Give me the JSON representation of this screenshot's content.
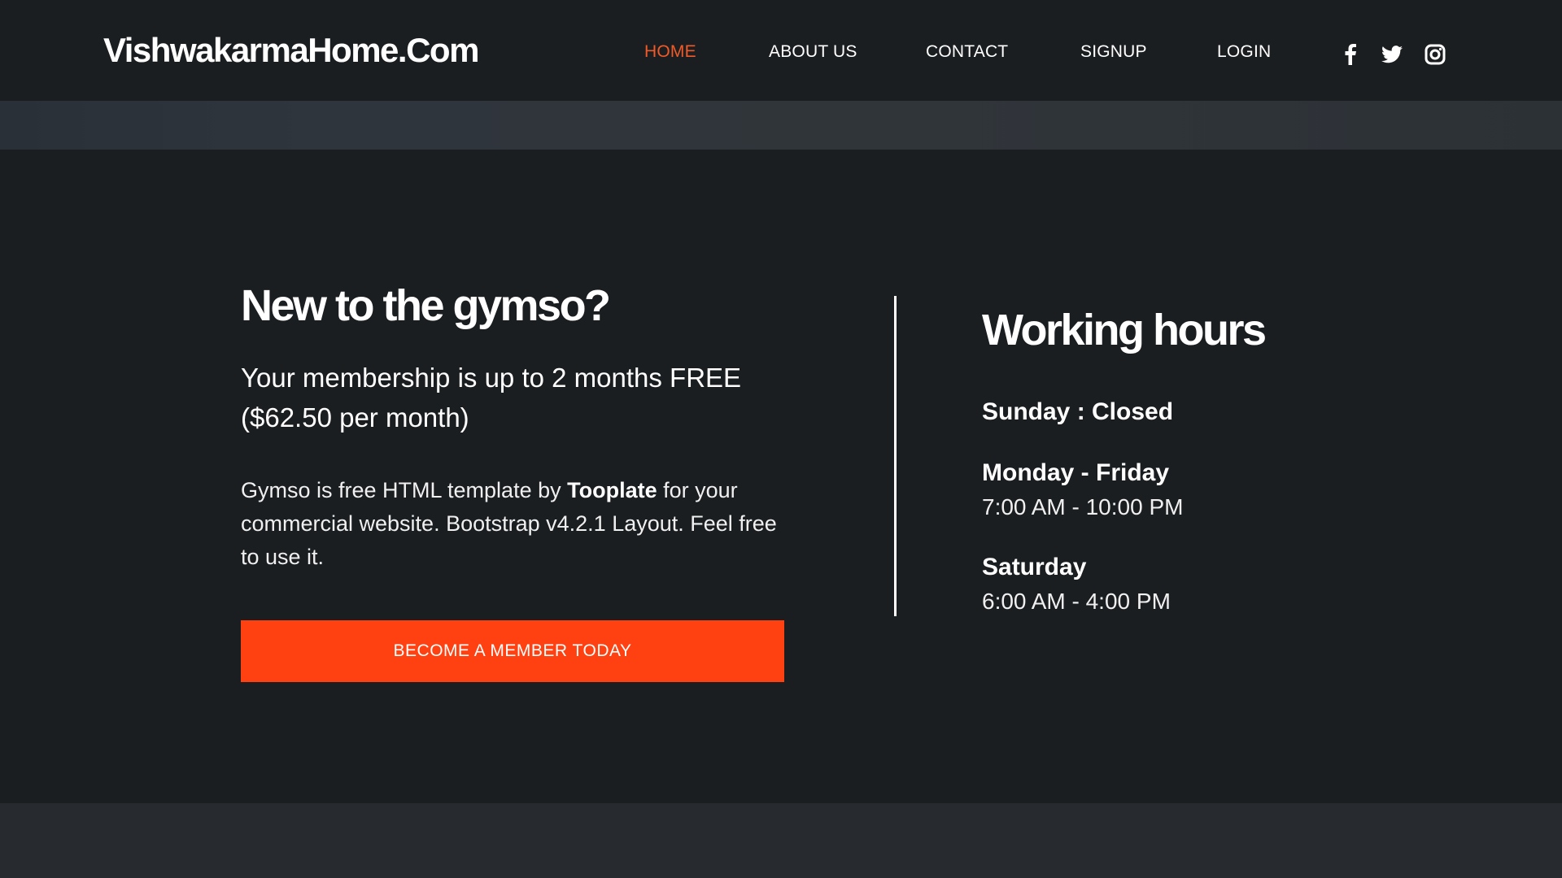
{
  "header": {
    "brand": "VishwakarmaHome.Com",
    "nav": [
      {
        "label": "HOME",
        "active": true
      },
      {
        "label": "ABOUT US"
      },
      {
        "label": "CONTACT"
      },
      {
        "label": "SIGNUP"
      },
      {
        "label": "LOGIN"
      }
    ],
    "social_icons": [
      "facebook-icon",
      "twitter-icon",
      "instagram-icon"
    ]
  },
  "promo": {
    "title": "New to the gymso?",
    "lead": "Your membership is up to 2 months FREE ($62.50 per month)",
    "text_before": "Gymso is free HTML template by ",
    "text_link": "Tooplate",
    "text_after": " for your commercial website. Bootstrap v4.2.1 Layout. Feel free to use it.",
    "cta_label": "BECOME A MEMBER TODAY"
  },
  "working_hours": {
    "title": "Working hours",
    "sunday": "Sunday : Closed",
    "weekdays_label": "Monday - Friday",
    "weekdays_hours": "7:00 AM - 10:00 PM",
    "saturday_label": "Saturday",
    "saturday_hours": "6:00 AM - 4:00 PM"
  },
  "colors": {
    "accent": "#f05a28",
    "cta": "#ff4010",
    "background": "#1b1e21"
  }
}
